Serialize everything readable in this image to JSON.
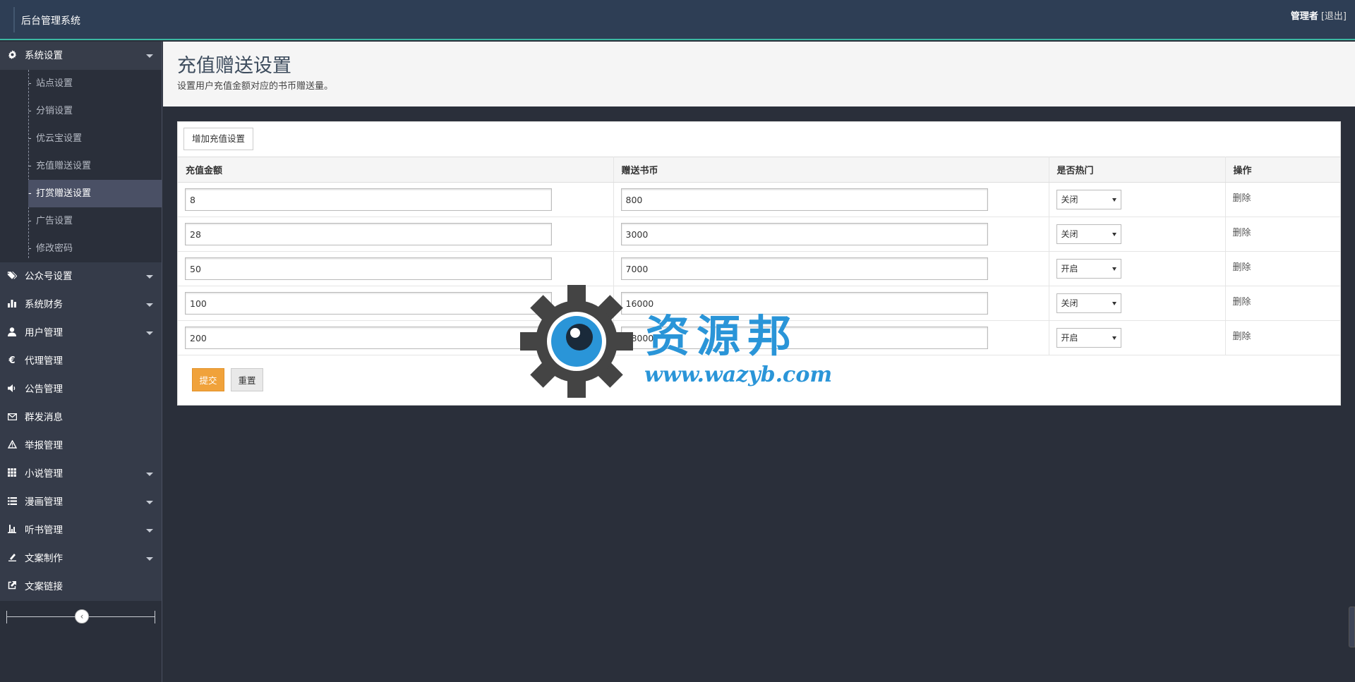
{
  "app": {
    "title": "后台管理系统"
  },
  "user": {
    "name": "管理者",
    "logout": "[退出]"
  },
  "sidebar": {
    "system": {
      "label": "系统设置",
      "items": [
        "站点设置",
        "分销设置",
        "优云宝设置",
        "充值赠送设置",
        "打赏赠送设置",
        "广告设置",
        "修改密码"
      ],
      "active_index": 4
    },
    "menus": [
      {
        "label": "公众号设置",
        "icon": "tags-icon",
        "has_caret": true
      },
      {
        "label": "系统财务",
        "icon": "bar-chart-icon",
        "has_caret": true
      },
      {
        "label": "用户管理",
        "icon": "user-icon",
        "has_caret": true
      },
      {
        "label": "代理管理",
        "icon": "euro-icon",
        "has_caret": false
      },
      {
        "label": "公告管理",
        "icon": "volume-icon",
        "has_caret": false
      },
      {
        "label": "群发消息",
        "icon": "envelope-icon",
        "has_caret": false
      },
      {
        "label": "举报管理",
        "icon": "warning-icon",
        "has_caret": false
      },
      {
        "label": "小说管理",
        "icon": "grid-icon",
        "has_caret": true
      },
      {
        "label": "漫画管理",
        "icon": "list-icon",
        "has_caret": true
      },
      {
        "label": "听书管理",
        "icon": "sliders-icon",
        "has_caret": true
      },
      {
        "label": "文案制作",
        "icon": "pen-icon",
        "has_caret": true
      },
      {
        "label": "文案链接",
        "icon": "share-icon",
        "has_caret": false
      }
    ],
    "collapse_glyph": "‹"
  },
  "header": {
    "title": "充值赠送设置",
    "subtitle": "设置用户充值金额对应的书币赠送量。"
  },
  "panel": {
    "add_label": "增加充值设置",
    "columns": [
      "充值金额",
      "赠送书币",
      "是否热门",
      "操作"
    ],
    "rows": [
      {
        "amount": "8",
        "coins": "800",
        "hot": "关闭",
        "action": "删除"
      },
      {
        "amount": "28",
        "coins": "3000",
        "hot": "关闭",
        "action": "删除"
      },
      {
        "amount": "50",
        "coins": "7000",
        "hot": "开启",
        "action": "删除"
      },
      {
        "amount": "100",
        "coins": "16000",
        "hot": "关闭",
        "action": "删除"
      },
      {
        "amount": "200",
        "coins": "38000",
        "hot": "开启",
        "action": "删除"
      }
    ],
    "submit_label": "提交",
    "reset_label": "重置"
  },
  "watermark": {
    "text": "资源邦",
    "url": "www.wazyb.com"
  },
  "colors": {
    "navbar": "#2e3e55",
    "accent_line": "#3bb8a3",
    "submit": "#f0a23b",
    "sidebar": "#2a2f3a",
    "watermark": "#2a95d8"
  }
}
